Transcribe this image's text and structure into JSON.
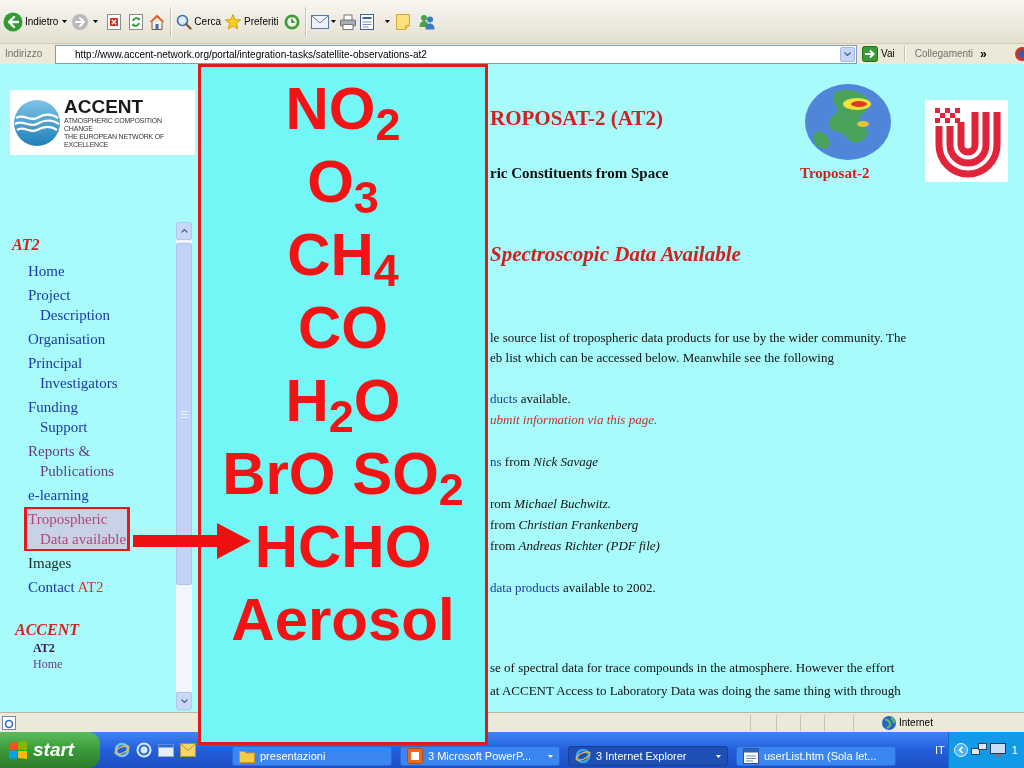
{
  "toolbar": {
    "back": "Indietro",
    "search": "Cerca",
    "favorites": "Preferiti"
  },
  "address_bar": {
    "label": "Indirizzo",
    "url": "http://www.accent-network.org/portal/integration-tasks/satellite-observations-at2",
    "go": "Vai",
    "links": "Collegamenti",
    "more": "»"
  },
  "sidebar": {
    "logo": {
      "name": "ACCENT",
      "tagline": [
        "ATMOSPHERIC COMPOSITION CHANGE",
        "THE EUROPEAN NETWORK OF EXCELLENCE"
      ]
    },
    "sections": [
      {
        "kind": "primary",
        "title": "AT2",
        "items": [
          {
            "lines": [
              "Home"
            ],
            "kind": "link",
            "selected": false,
            "highlighted": false
          },
          {
            "lines": [
              "Project",
              "Description"
            ],
            "kind": "link",
            "selected": false,
            "highlighted": false
          },
          {
            "lines": [
              "Organisation"
            ],
            "kind": "link",
            "selected": false,
            "highlighted": false
          },
          {
            "lines": [
              "Principal",
              "Investigators"
            ],
            "kind": "link",
            "selected": false,
            "highlighted": false
          },
          {
            "lines": [
              "Funding",
              "Support"
            ],
            "kind": "link",
            "selected": false,
            "highlighted": false
          },
          {
            "lines": [
              "Reports &",
              "Publications"
            ],
            "kind": "visited",
            "selected": false,
            "highlighted": false
          },
          {
            "lines": [
              "e-learning"
            ],
            "kind": "link",
            "selected": false,
            "highlighted": false
          },
          {
            "lines": [
              "Tropospheric",
              "Data available"
            ],
            "kind": "active",
            "selected": true,
            "highlighted": true
          },
          {
            "lines": [
              "Images"
            ],
            "kind": "plain",
            "selected": false,
            "highlighted": false
          },
          {
            "lines": [
              "Contact"
            ],
            "suffix": "AT2",
            "kind": "link",
            "selected": false,
            "highlighted": false
          }
        ]
      },
      {
        "kind": "secondary",
        "title": "ACCENT",
        "items": [
          {
            "lines": [
              "AT2"
            ],
            "kind": "current",
            "selected": false,
            "highlighted": false
          },
          {
            "lines": [
              "Home"
            ],
            "kind": "visited",
            "selected": false,
            "highlighted": false
          }
        ]
      }
    ]
  },
  "main": {
    "title": "ROPOSAT-2 (AT2)",
    "subtitle": "ric Constituents from Space",
    "figure_caption": "Troposat-2",
    "heading": "Spectroscopic Data Available",
    "intro": [
      "le source list of tropospheric data products for use by the wider community. The",
      "eb list which can be accessed below. Meanwhile see the following"
    ],
    "lists": [
      [
        [
          {
            "text": "ducts",
            "kind": "link"
          },
          {
            "text": " available.",
            "kind": "plain"
          }
        ],
        [
          {
            "text": "ubmit information via this page.",
            "kind": "note"
          }
        ]
      ],
      [
        [
          {
            "text": "ns",
            "kind": "link"
          },
          {
            "text": " from ",
            "kind": "plain"
          },
          {
            "text": "Nick Savage",
            "kind": "italic"
          }
        ]
      ],
      [
        [
          {
            "text": "rom ",
            "kind": "plain"
          },
          {
            "text": "Michael Buchwitz.",
            "kind": "italic"
          }
        ],
        [
          {
            "text": "from ",
            "kind": "plain"
          },
          {
            "text": "Christian Frankenberg",
            "kind": "italic"
          }
        ],
        [
          {
            "text": "from ",
            "kind": "plain"
          },
          {
            "text": "Andreas Richter (PDF file)",
            "kind": "italic"
          }
        ]
      ],
      [
        [
          {
            "text": "data products",
            "kind": "link"
          },
          {
            "text": " available to 2002.",
            "kind": "plain"
          }
        ]
      ]
    ],
    "closing": [
      "se of spectral data for trace compounds in the atmosphere. However the effort",
      "at ACCENT Access to Laboratory Data was doing the same thing with through"
    ]
  },
  "overlay": {
    "lines": [
      "NO$_{2}$",
      "O$_{3}$",
      "CH$_{4}$",
      "CO",
      "H$_{2}$O",
      "BrO SO$_{2}$",
      "HCHO",
      "Aerosol"
    ]
  },
  "status_bar": {
    "zone": "Internet"
  },
  "taskbar": {
    "start": "start",
    "tasks": [
      {
        "label": "presentazioni",
        "kind": "folder",
        "grouped": false,
        "selected": false
      },
      {
        "label": "3 Microsoft PowerP...",
        "kind": "slides",
        "grouped": true,
        "selected": false
      },
      {
        "label": "3 Internet Explorer",
        "kind": "browser",
        "grouped": true,
        "selected": true
      },
      {
        "label": "userList.htm (Sola let...",
        "kind": "document",
        "grouped": false,
        "selected": false
      }
    ],
    "language": "IT",
    "clock": "1"
  }
}
